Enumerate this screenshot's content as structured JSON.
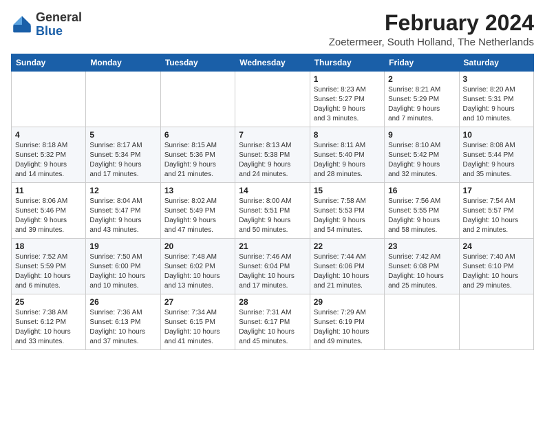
{
  "logo": {
    "general": "General",
    "blue": "Blue"
  },
  "title": "February 2024",
  "location": "Zoetermeer, South Holland, The Netherlands",
  "days_of_week": [
    "Sunday",
    "Monday",
    "Tuesday",
    "Wednesday",
    "Thursday",
    "Friday",
    "Saturday"
  ],
  "weeks": [
    [
      {
        "day": "",
        "info": ""
      },
      {
        "day": "",
        "info": ""
      },
      {
        "day": "",
        "info": ""
      },
      {
        "day": "",
        "info": ""
      },
      {
        "day": "1",
        "info": "Sunrise: 8:23 AM\nSunset: 5:27 PM\nDaylight: 9 hours\nand 3 minutes."
      },
      {
        "day": "2",
        "info": "Sunrise: 8:21 AM\nSunset: 5:29 PM\nDaylight: 9 hours\nand 7 minutes."
      },
      {
        "day": "3",
        "info": "Sunrise: 8:20 AM\nSunset: 5:31 PM\nDaylight: 9 hours\nand 10 minutes."
      }
    ],
    [
      {
        "day": "4",
        "info": "Sunrise: 8:18 AM\nSunset: 5:32 PM\nDaylight: 9 hours\nand 14 minutes."
      },
      {
        "day": "5",
        "info": "Sunrise: 8:17 AM\nSunset: 5:34 PM\nDaylight: 9 hours\nand 17 minutes."
      },
      {
        "day": "6",
        "info": "Sunrise: 8:15 AM\nSunset: 5:36 PM\nDaylight: 9 hours\nand 21 minutes."
      },
      {
        "day": "7",
        "info": "Sunrise: 8:13 AM\nSunset: 5:38 PM\nDaylight: 9 hours\nand 24 minutes."
      },
      {
        "day": "8",
        "info": "Sunrise: 8:11 AM\nSunset: 5:40 PM\nDaylight: 9 hours\nand 28 minutes."
      },
      {
        "day": "9",
        "info": "Sunrise: 8:10 AM\nSunset: 5:42 PM\nDaylight: 9 hours\nand 32 minutes."
      },
      {
        "day": "10",
        "info": "Sunrise: 8:08 AM\nSunset: 5:44 PM\nDaylight: 9 hours\nand 35 minutes."
      }
    ],
    [
      {
        "day": "11",
        "info": "Sunrise: 8:06 AM\nSunset: 5:46 PM\nDaylight: 9 hours\nand 39 minutes."
      },
      {
        "day": "12",
        "info": "Sunrise: 8:04 AM\nSunset: 5:47 PM\nDaylight: 9 hours\nand 43 minutes."
      },
      {
        "day": "13",
        "info": "Sunrise: 8:02 AM\nSunset: 5:49 PM\nDaylight: 9 hours\nand 47 minutes."
      },
      {
        "day": "14",
        "info": "Sunrise: 8:00 AM\nSunset: 5:51 PM\nDaylight: 9 hours\nand 50 minutes."
      },
      {
        "day": "15",
        "info": "Sunrise: 7:58 AM\nSunset: 5:53 PM\nDaylight: 9 hours\nand 54 minutes."
      },
      {
        "day": "16",
        "info": "Sunrise: 7:56 AM\nSunset: 5:55 PM\nDaylight: 9 hours\nand 58 minutes."
      },
      {
        "day": "17",
        "info": "Sunrise: 7:54 AM\nSunset: 5:57 PM\nDaylight: 10 hours\nand 2 minutes."
      }
    ],
    [
      {
        "day": "18",
        "info": "Sunrise: 7:52 AM\nSunset: 5:59 PM\nDaylight: 10 hours\nand 6 minutes."
      },
      {
        "day": "19",
        "info": "Sunrise: 7:50 AM\nSunset: 6:00 PM\nDaylight: 10 hours\nand 10 minutes."
      },
      {
        "day": "20",
        "info": "Sunrise: 7:48 AM\nSunset: 6:02 PM\nDaylight: 10 hours\nand 13 minutes."
      },
      {
        "day": "21",
        "info": "Sunrise: 7:46 AM\nSunset: 6:04 PM\nDaylight: 10 hours\nand 17 minutes."
      },
      {
        "day": "22",
        "info": "Sunrise: 7:44 AM\nSunset: 6:06 PM\nDaylight: 10 hours\nand 21 minutes."
      },
      {
        "day": "23",
        "info": "Sunrise: 7:42 AM\nSunset: 6:08 PM\nDaylight: 10 hours\nand 25 minutes."
      },
      {
        "day": "24",
        "info": "Sunrise: 7:40 AM\nSunset: 6:10 PM\nDaylight: 10 hours\nand 29 minutes."
      }
    ],
    [
      {
        "day": "25",
        "info": "Sunrise: 7:38 AM\nSunset: 6:12 PM\nDaylight: 10 hours\nand 33 minutes."
      },
      {
        "day": "26",
        "info": "Sunrise: 7:36 AM\nSunset: 6:13 PM\nDaylight: 10 hours\nand 37 minutes."
      },
      {
        "day": "27",
        "info": "Sunrise: 7:34 AM\nSunset: 6:15 PM\nDaylight: 10 hours\nand 41 minutes."
      },
      {
        "day": "28",
        "info": "Sunrise: 7:31 AM\nSunset: 6:17 PM\nDaylight: 10 hours\nand 45 minutes."
      },
      {
        "day": "29",
        "info": "Sunrise: 7:29 AM\nSunset: 6:19 PM\nDaylight: 10 hours\nand 49 minutes."
      },
      {
        "day": "",
        "info": ""
      },
      {
        "day": "",
        "info": ""
      }
    ]
  ]
}
